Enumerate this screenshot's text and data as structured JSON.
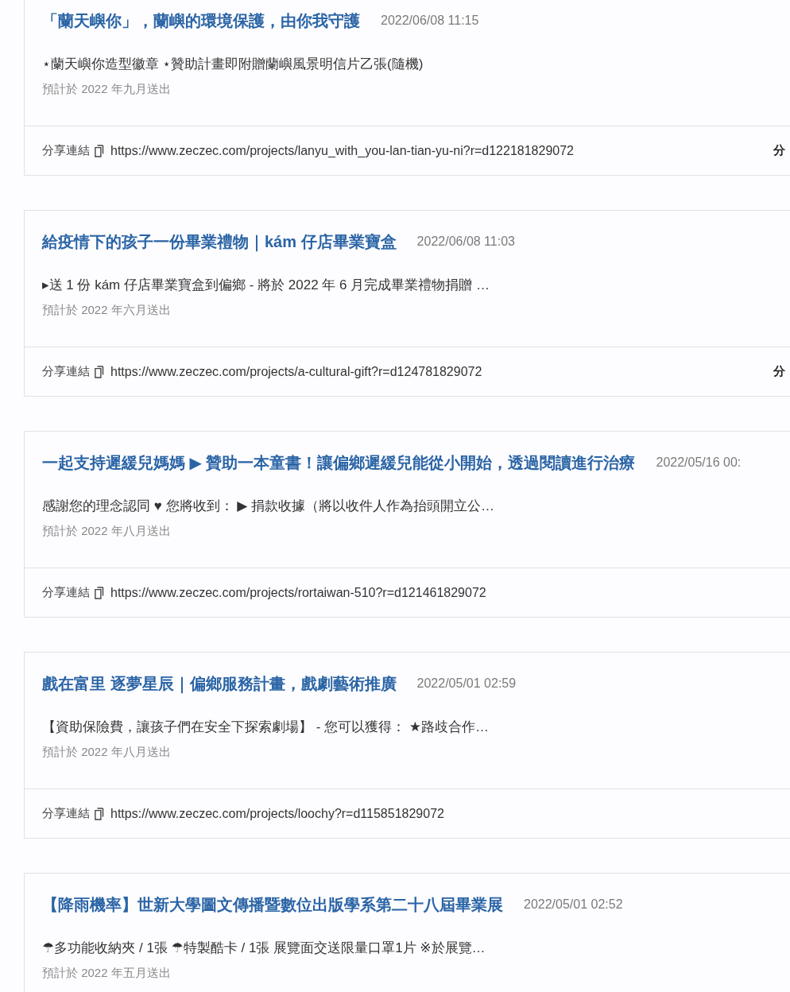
{
  "rewards": [
    {
      "title": "「蘭天嶼你」，蘭嶼的環境保護，由你我守護",
      "date": "2022/06/08 11:15",
      "description": "⋆蘭天嶼你造型徽章 ⋆贊助計畫即附贈蘭嶼風景明信片乙張(隨機)",
      "delivery": "預計於 2022 年九月送出",
      "share_label": "分享連結",
      "share_url": "https://www.zeczec.com/projects/lanyu_with_you-lan-tian-yu-ni?r=d122181829072",
      "share_action": "分"
    },
    {
      "title": "給疫情下的孩子一份畢業禮物｜kám 仔店畢業寶盒",
      "date": "2022/06/08 11:03",
      "description": "▸送 1 份 kám 仔店畢業寶盒到偏鄉 - 將於 2022 年 6 月完成畢業禮物捐贈 …",
      "delivery": "預計於 2022 年六月送出",
      "share_label": "分享連結",
      "share_url": "https://www.zeczec.com/projects/a-cultural-gift?r=d124781829072",
      "share_action": "分"
    },
    {
      "title": "一起支持遲緩兒媽媽 ▶ 贊助一本童書！讓偏鄉遲緩兒能從小開始，透過閱讀進行治療",
      "date": "2022/05/16 00:",
      "description": "感謝您的理念認同 ♥ 您將收到： ▶ 捐款收據（將以收件人作為抬頭開立公…",
      "delivery": "預計於 2022 年八月送出",
      "share_label": "分享連結",
      "share_url": "https://www.zeczec.com/projects/rortaiwan-510?r=d121461829072"
    },
    {
      "title": "戲在富里 逐夢星辰｜偏鄉服務計畫，戲劇藝術推廣",
      "date": "2022/05/01 02:59",
      "description": "【資助保險費，讓孩子們在安全下探索劇場】 - 您可以獲得： ★路歧合作…",
      "delivery": "預計於 2022 年八月送出",
      "share_label": "分享連結",
      "share_url": "https://www.zeczec.com/projects/loochy?r=d115851829072"
    },
    {
      "title": "【降雨機率】世新大學圖文傳播暨數位出版學系第二十八屆畢業展",
      "date": "2022/05/01 02:52",
      "description": "☂多功能收納夾 / 1張 ☂特製酷卡 / 1張 展覽面交送限量口罩1片 ※於展覽…",
      "delivery": "預計於 2022 年五月送出"
    }
  ]
}
